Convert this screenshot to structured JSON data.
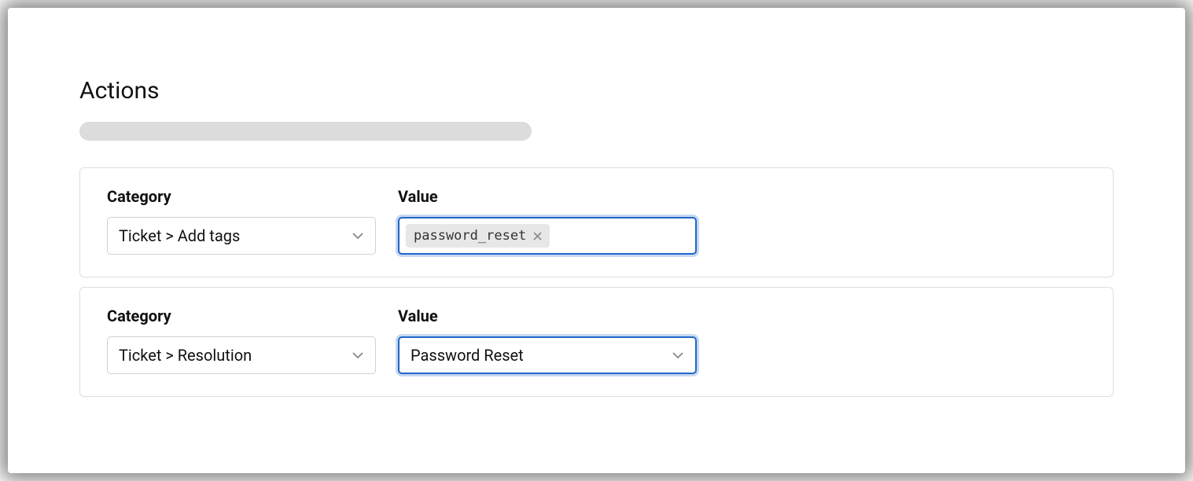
{
  "section": {
    "title": "Actions"
  },
  "actions": [
    {
      "category_label": "Category",
      "category_value": "Ticket > Add tags",
      "value_label": "Value",
      "tag_value": "password_reset"
    },
    {
      "category_label": "Category",
      "category_value": "Ticket > Resolution",
      "value_label": "Value",
      "select_value": "Password Reset"
    }
  ]
}
